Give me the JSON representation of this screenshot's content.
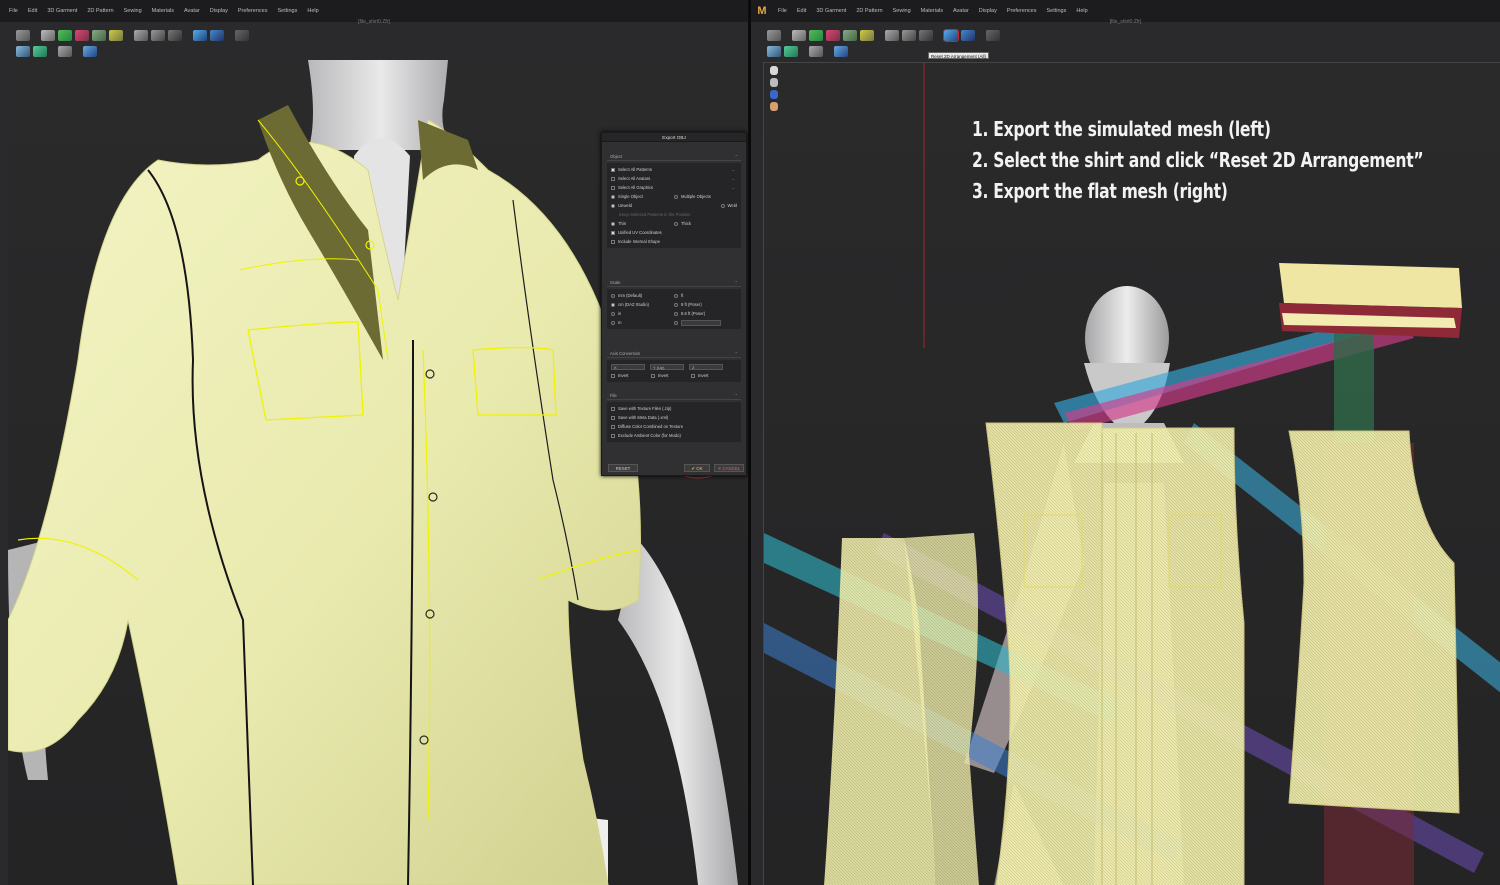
{
  "app": {
    "logo": "M",
    "file_title": "[file_shirt0.Zfr]",
    "menu": [
      "File",
      "Edit",
      "3D Garment",
      "2D Pattern",
      "Sewing",
      "Materials",
      "Avatar",
      "Display",
      "Preferences",
      "Settings",
      "Help"
    ]
  },
  "toolbar": {
    "row1_icons": [
      "transform-icon",
      "select-mesh-icon",
      "colorway-icon",
      "avatar-color-icon",
      "material-icon",
      "fold-icon",
      "pin-icon",
      "measure-icon",
      "arrangement-icon",
      "hanger-icon",
      "screenshot-icon"
    ],
    "row2_icons": [
      "layer-icon",
      "snapshot-icon",
      "size-icon",
      "grading-icon"
    ]
  },
  "export_dialog": {
    "title": "Export OBJ",
    "object_section": {
      "header": "Object",
      "select_all_patterns": "Select All Patterns",
      "select_all_avatars": "Select All Avatars",
      "select_all_graphics": "Select All Graphics",
      "single_object": "Single Object",
      "multiple_objects": "Multiple Objects",
      "unweld": "Unweld",
      "weld": "Weld",
      "keep_note": "Keep Selected Patterns in the Position",
      "thin": "Thin",
      "thick": "Thick",
      "unified_uv": "Unified UV Coordinates",
      "include_internal": "Include Internal Shape"
    },
    "scale_section": {
      "header": "Scale",
      "mm": "mm (Default)",
      "ft": "ft",
      "cm": "cm (DAZ Studio)",
      "eight_ft": "8 ft (Poser)",
      "in": "in",
      "eight_six_ft": "8.6 ft (Poser)",
      "m": "m"
    },
    "axis_section": {
      "header": "Axis Conversion",
      "x_value": "X",
      "y_value": "Y (Up)",
      "z_value": "Z",
      "invert": "Invert"
    },
    "file_section": {
      "header": "File",
      "save_texture": "Save with Texture Files (.zip)",
      "save_meta": "Save with Meta Data (.xml)",
      "diffuse_combined": "Diffuse Color Combined on Texture",
      "exclude_ambient": "Exclude Ambient Color (for Modo)"
    },
    "buttons": {
      "reset": "RESET",
      "ok": "✔ OK",
      "cancel": "✕ CANCEL"
    }
  },
  "tooltip": "Reset 2D Arrangement (All)",
  "instructions": [
    "1. Export the simulated mesh (left)",
    "2. Select the shirt and click “Reset 2D Arrangement”",
    "3. Export the flat mesh (right)"
  ],
  "colors": {
    "shirt": "#ecedb2",
    "seam_highlight": "#f0f200",
    "annotation_red": "#c0282e",
    "background": "#2a2a2c"
  }
}
